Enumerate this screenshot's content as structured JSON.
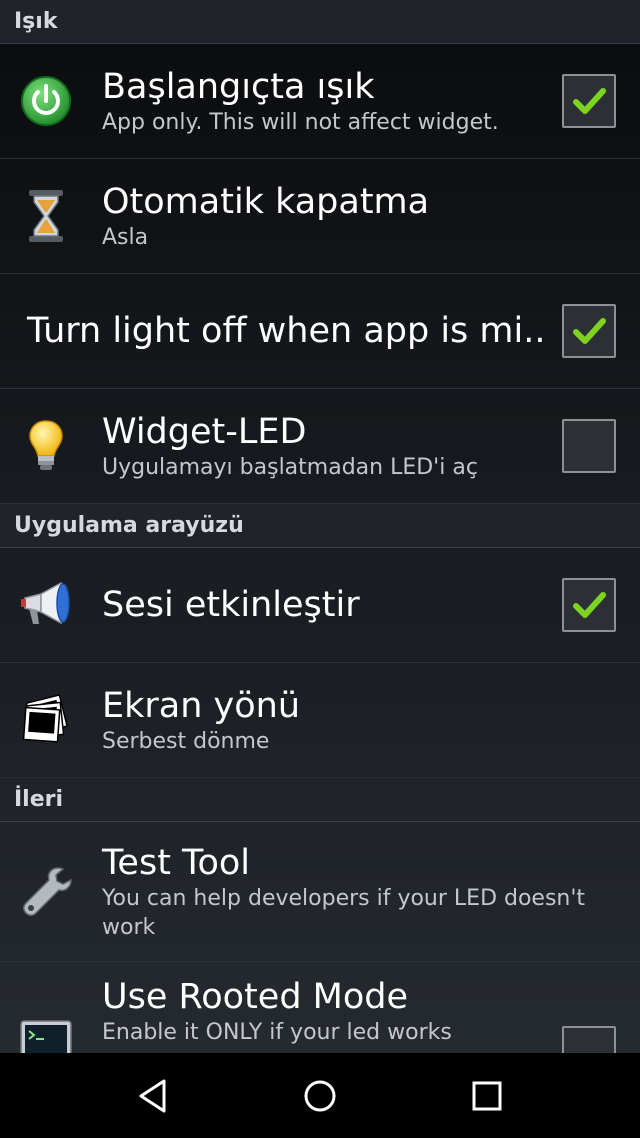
{
  "sections": [
    {
      "title": "Işık"
    },
    {
      "title": "Uygulama arayüzü"
    },
    {
      "title": "İleri"
    }
  ],
  "prefs": {
    "startup_light": {
      "title": "Başlangıçta ışık",
      "summary": "App only. This will not affect widget.",
      "checked": true,
      "icon": "power-icon"
    },
    "auto_off": {
      "title": "Otomatik kapatma",
      "summary": "Asla",
      "icon": "hourglass-icon"
    },
    "light_off_minimized": {
      "title": "Turn light off when app is mi..",
      "checked": true
    },
    "widget_led": {
      "title": "Widget-LED",
      "summary": "Uygulamayı başlatmadan LED'i aç",
      "checked": false,
      "icon": "lightbulb-icon"
    },
    "sound": {
      "title": "Sesi etkinleştir",
      "checked": true,
      "icon": "megaphone-icon"
    },
    "orientation": {
      "title": "Ekran yönü",
      "summary": "Serbest dönme",
      "icon": "photos-icon"
    },
    "test_tool": {
      "title": "Test Tool",
      "summary": "You can help developers if your LED doesn't work",
      "icon": "wrench-icon"
    },
    "rooted_mode": {
      "title": "Use Rooted Mode",
      "summary": "Enable it ONLY if your led works",
      "checked": false,
      "icon": "terminal-icon"
    }
  },
  "colors": {
    "accent_check": "#7ed321",
    "background": "#1c1f24",
    "header": "#20242a"
  },
  "navbar": {
    "back": "back-icon",
    "home": "home-icon",
    "recents": "recents-icon"
  }
}
